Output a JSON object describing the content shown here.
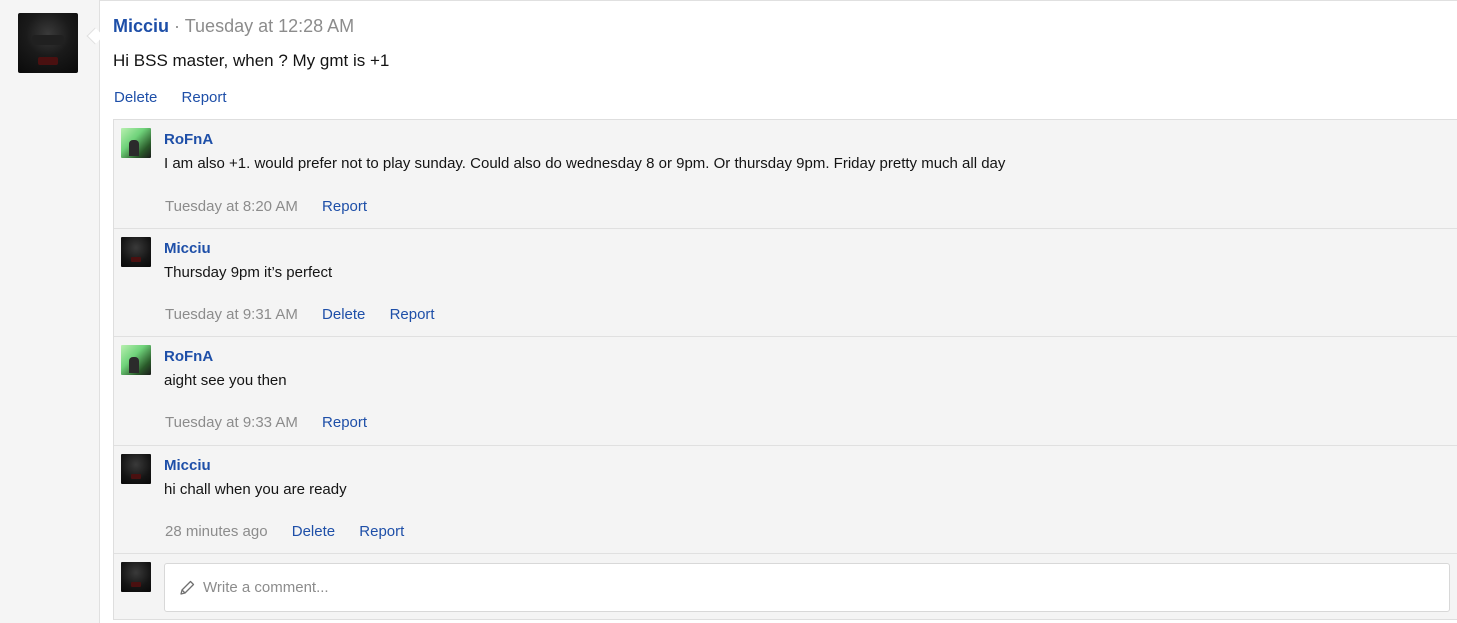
{
  "post": {
    "author": "Micciu",
    "separator": "·",
    "time": "Tuesday at 12:28 AM",
    "body": "Hi BSS master, when ? My gmt is +1",
    "actions": {
      "delete": "Delete",
      "report": "Report"
    }
  },
  "comments": [
    {
      "author": "RoFnA",
      "avatar": "green-avatar",
      "text": "I am also +1. would prefer not to play sunday. Could also do wednesday 8 or 9pm. Or thursday 9pm. Friday pretty much all day",
      "time": "Tuesday at 8:20 AM",
      "report": "Report"
    },
    {
      "author": "Micciu",
      "avatar": "dark-avatar",
      "text": "Thursday 9pm it’s perfect",
      "time": "Tuesday at 9:31 AM",
      "delete": "Delete",
      "report": "Report"
    },
    {
      "author": "RoFnA",
      "avatar": "green-avatar",
      "text": "aight see you then",
      "time": "Tuesday at 9:33 AM",
      "report": "Report"
    },
    {
      "author": "Micciu",
      "avatar": "dark-avatar",
      "text": "hi chall when you are ready",
      "time": "28 minutes ago",
      "delete": "Delete",
      "report": "Report"
    }
  ],
  "comment_box": {
    "placeholder": "Write a comment...",
    "icon": "pencil-icon"
  },
  "colors": {
    "link": "#1e4fa8",
    "muted": "#8c8c8c",
    "panel": "#f4f4f4"
  }
}
